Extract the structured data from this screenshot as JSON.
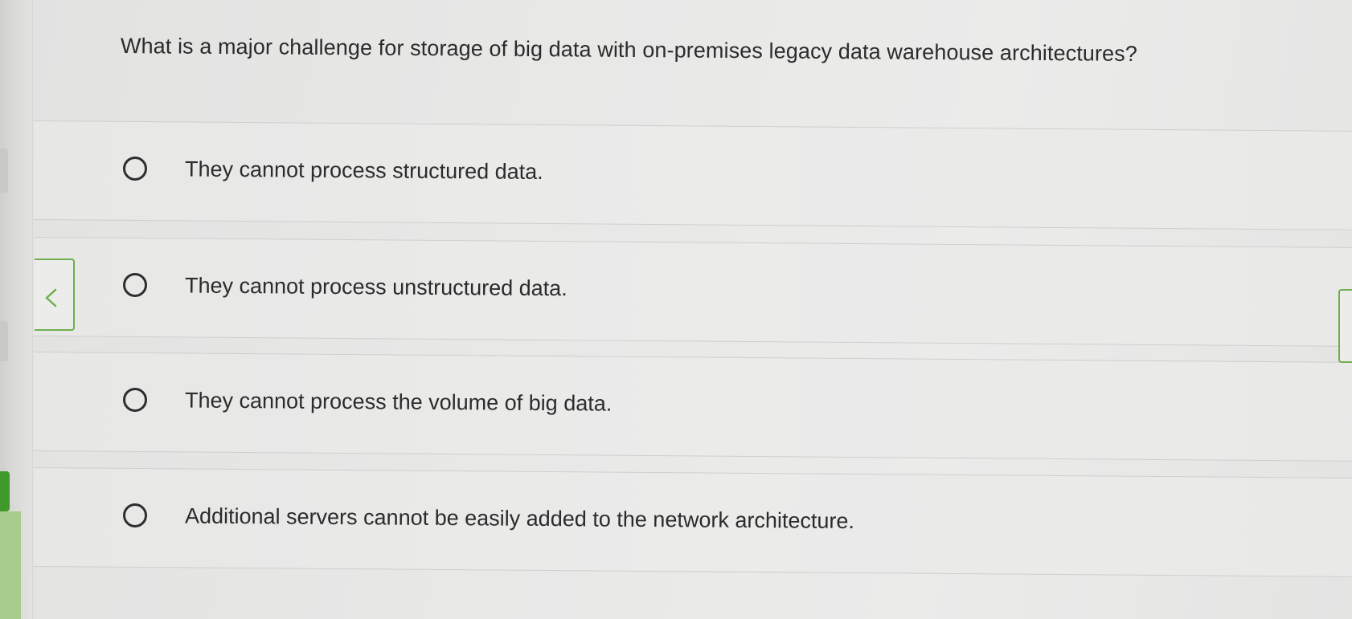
{
  "question": {
    "text": "What is a major challenge for storage of big data with on-premises legacy data warehouse architectures?"
  },
  "options": [
    {
      "label": "They cannot process structured data.",
      "selected": false
    },
    {
      "label": "They cannot process unstructured data.",
      "selected": false
    },
    {
      "label": "They cannot process the volume of big data.",
      "selected": false
    },
    {
      "label": "Additional servers cannot be easily added to the network architecture.",
      "selected": false
    }
  ],
  "navigation": {
    "prev_icon": "chevron-left-icon",
    "next_icon": "chevron-right-icon"
  },
  "colors": {
    "accent": "#6fae4e",
    "progress": "#3f9a2b",
    "text": "#2b2b2b"
  }
}
